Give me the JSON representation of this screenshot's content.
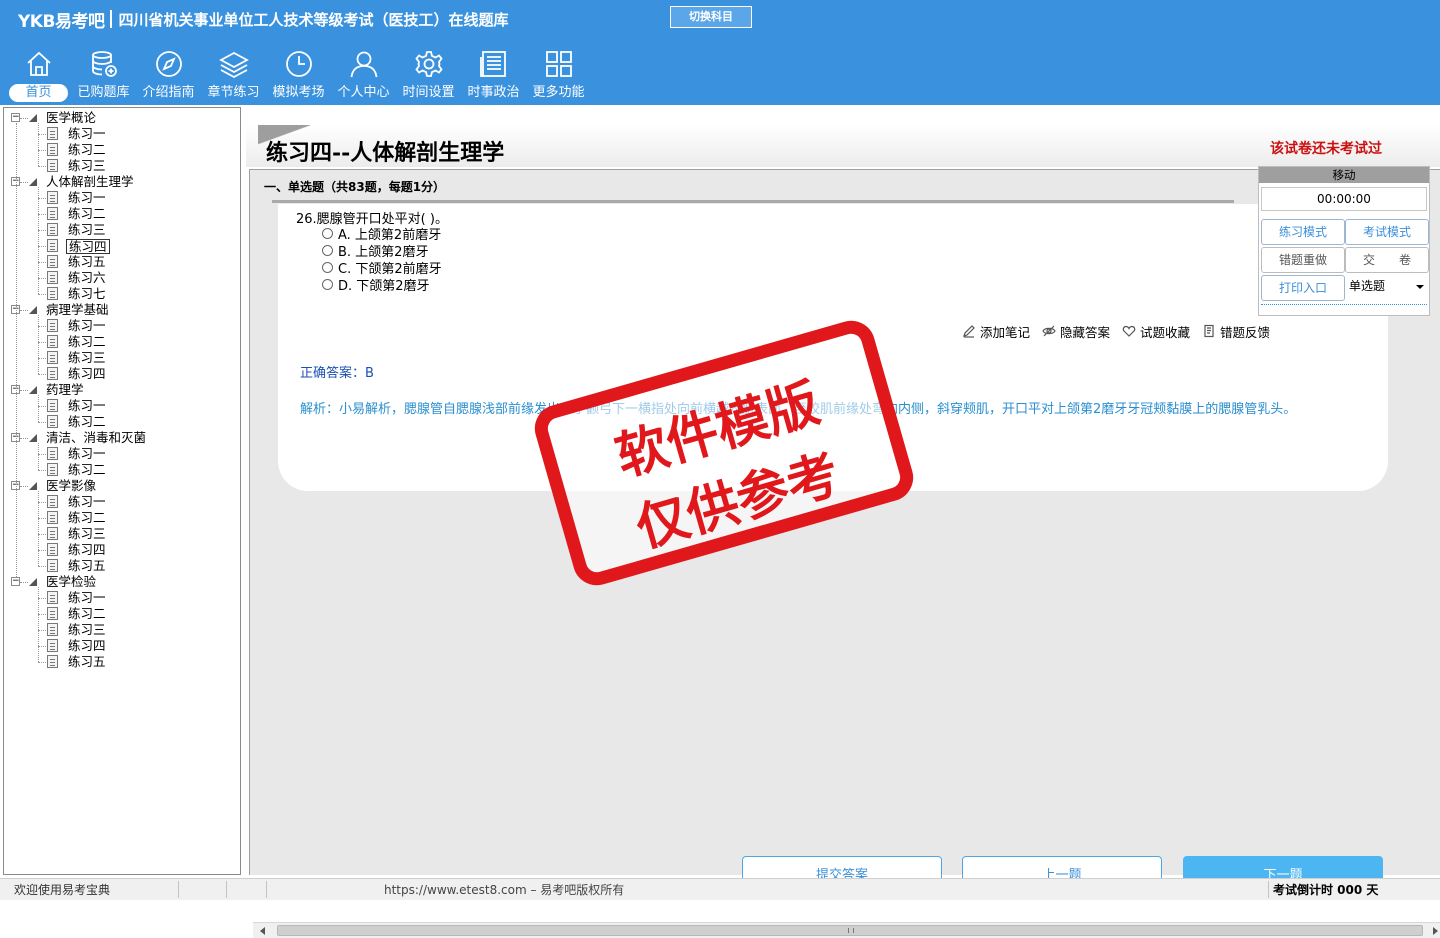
{
  "header": {
    "logo": "YKB易考吧",
    "title": "四川省机关事业单位工人技术等级考试（医技工）在线题库",
    "switch_subject": "切换科目",
    "accent_color": "#3a92df"
  },
  "nav": {
    "items": [
      {
        "label": "首页",
        "icon": "home-icon"
      },
      {
        "label": "已购题库",
        "icon": "database-icon"
      },
      {
        "label": "介绍指南",
        "icon": "compass-icon"
      },
      {
        "label": "章节练习",
        "icon": "layers-icon"
      },
      {
        "label": "模拟考场",
        "icon": "clock-icon"
      },
      {
        "label": "个人中心",
        "icon": "user-icon"
      },
      {
        "label": "时间设置",
        "icon": "gear-icon"
      },
      {
        "label": "时事政治",
        "icon": "news-icon"
      },
      {
        "label": "更多功能",
        "icon": "grid-icon"
      }
    ],
    "active_index": 0
  },
  "tree": {
    "categories": [
      {
        "label": "医学概论",
        "items": [
          "练习一",
          "练习二",
          "练习三"
        ]
      },
      {
        "label": "人体解剖生理学",
        "items": [
          "练习一",
          "练习二",
          "练习三",
          "练习四",
          "练习五",
          "练习六",
          "练习七"
        ]
      },
      {
        "label": "病理学基础",
        "items": [
          "练习一",
          "练习二",
          "练习三",
          "练习四"
        ]
      },
      {
        "label": "药理学",
        "items": [
          "练习一",
          "练习二"
        ]
      },
      {
        "label": "清洁、消毒和灭菌",
        "items": [
          "练习一",
          "练习二"
        ]
      },
      {
        "label": "医学影像",
        "items": [
          "练习一",
          "练习二",
          "练习三",
          "练习四",
          "练习五"
        ]
      },
      {
        "label": "医学检验",
        "items": [
          "练习一",
          "练习二",
          "练习三",
          "练习四",
          "练习五"
        ]
      }
    ],
    "selected": {
      "category": 1,
      "item": 3
    }
  },
  "exam": {
    "title": "练习四--人体解剖生理学",
    "status": "该试卷还未考试过",
    "section_header": "一、单选题（共83题，每题1分）"
  },
  "question": {
    "stem": "26.腮腺管开口处平对( )。",
    "options": [
      "A. 上颌第2前磨牙",
      "B. 上颌第2磨牙",
      "C. 下颌第2前磨牙",
      "D. 下颌第2磨牙"
    ],
    "tools": [
      {
        "label": "添加笔记",
        "icon": "pencil-icon"
      },
      {
        "label": "隐藏答案",
        "icon": "eye-icon"
      },
      {
        "label": "试题收藏",
        "icon": "heart-icon"
      },
      {
        "label": "错题反馈",
        "icon": "feedback-icon"
      }
    ],
    "answer": "正确答案：B",
    "analysis": "解析：小易解析，腮腺管自腮腺浅部前缘发出，于颧弓下一横指处向前横越咬肌表面，至咬肌前缘处弯向内侧，斜穿颊肌，开口平对上颌第2磨牙牙冠颊黏膜上的腮腺管乳头。"
  },
  "control_panel": {
    "move": "移动",
    "timer": "00:00:00",
    "practice_mode": "练习模式",
    "exam_mode": "考试模式",
    "redo_wrong": "错题重做",
    "submit_paper": "交　　卷",
    "print_entry": "打印入口",
    "question_type": "单选题"
  },
  "buttons": {
    "submit": "提交答案",
    "prev": "上一题",
    "next": "下一题"
  },
  "watermark": {
    "line1": "软件模版",
    "line2": "仅供参考"
  },
  "status_bar": {
    "welcome": "欢迎使用易考宝典",
    "copyright": "https://www.etest8.com – 易考吧版权所有",
    "countdown": "考试倒计时 000 天"
  }
}
